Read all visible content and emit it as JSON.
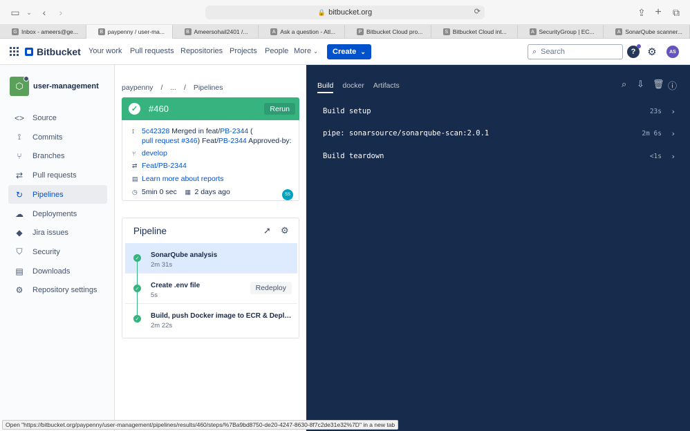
{
  "browser": {
    "url": "bitbucket.org",
    "tabs": [
      {
        "label": "Inbox - ameers@ge...",
        "favicon": "G"
      },
      {
        "label": "paypenny / user-ma...",
        "favicon": "B"
      },
      {
        "label": "Ameersohail2401 /...",
        "favicon": "B"
      },
      {
        "label": "Ask a question - Atl...",
        "favicon": "A"
      },
      {
        "label": "Bitbucket Cloud pro...",
        "favicon": "P"
      },
      {
        "label": "Bitbucket Cloud int...",
        "favicon": "S"
      },
      {
        "label": "SecurityGroup | EC...",
        "favicon": "A"
      },
      {
        "label": "SonarQube scanner...",
        "favicon": "A"
      }
    ],
    "status_text": "Open \"https://bitbucket.org/paypenny/user-management/pipelines/results/460/steps/%7Ba9bd8750-de20-4247-8630-8f7c2de31e32%7D\" in a new tab"
  },
  "header": {
    "product": "Bitbucket",
    "nav": [
      "Your work",
      "Pull requests",
      "Repositories",
      "Projects",
      "People",
      "More"
    ],
    "create_label": "Create",
    "search_placeholder": "Search",
    "help_label": "?",
    "avatar_initials": "AS"
  },
  "sidebar": {
    "repo_name": "user-management",
    "items": [
      {
        "label": "Source",
        "icon": "<>"
      },
      {
        "label": "Commits",
        "icon": "⟟"
      },
      {
        "label": "Branches",
        "icon": "⑂"
      },
      {
        "label": "Pull requests",
        "icon": "⇄"
      },
      {
        "label": "Pipelines",
        "icon": "↻"
      },
      {
        "label": "Deployments",
        "icon": "☁"
      },
      {
        "label": "Jira issues",
        "icon": "◆"
      },
      {
        "label": "Security",
        "icon": "⛉"
      },
      {
        "label": "Downloads",
        "icon": "▤"
      },
      {
        "label": "Repository settings",
        "icon": "⚙"
      }
    ]
  },
  "breadcrumb": [
    "paypenny",
    "/",
    "...",
    "/",
    "Pipelines"
  ],
  "run": {
    "number": "#460",
    "rerun_label": "Rerun",
    "commit_hash": "5c42328",
    "commit_msg_1": " Merged in feat/",
    "commit_link_1": "PB-2344",
    "commit_msg_2": " (",
    "pr_link": "pull request #346",
    "commit_msg_3": ") Feat/",
    "commit_link_2": "PB-2344",
    "commit_msg_4": " Approved-by:",
    "branch": "develop",
    "source_branch": "Feat/PB-2344",
    "reports_link": "Learn more about reports",
    "duration": "5min 0 sec",
    "when": "2 days ago",
    "author_initials": "SS"
  },
  "pipeline": {
    "title": "Pipeline",
    "steps": [
      {
        "name": "SonarQube analysis",
        "duration": "2m 31s"
      },
      {
        "name": "Create .env file",
        "duration": "5s",
        "action": "Redeploy"
      },
      {
        "name": "Build, push Docker image to ECR & Deploy to ECS",
        "duration": "2m 22s"
      }
    ]
  },
  "log": {
    "tabs": [
      "Build",
      "docker",
      "Artifacts"
    ],
    "rows": [
      {
        "text": "Build setup",
        "duration": "23s"
      },
      {
        "text": "pipe: sonarsource/sonarqube-scan:2.0.1",
        "duration": "2m 6s"
      },
      {
        "text": "Build teardown",
        "duration": "<1s"
      }
    ]
  },
  "colors": {
    "success": "#36b37e",
    "brand": "#0052cc",
    "log_bg": "#172b4d"
  }
}
